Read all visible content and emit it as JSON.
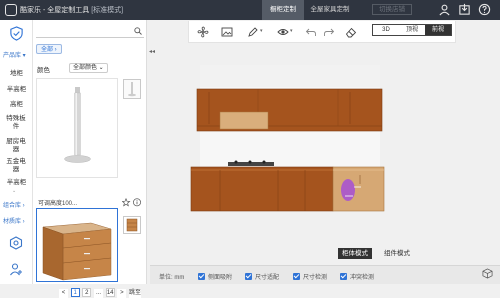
{
  "titlebar": {
    "app_name": "酷家乐 - 全屋定制工具",
    "mode": "[标准模式]",
    "tabs": [
      {
        "label": "橱柜定制",
        "state": "active"
      },
      {
        "label": "全屋家具定制",
        "state": "normal"
      },
      {
        "label": "切换店铺",
        "state": "disabled"
      }
    ],
    "icons": [
      "user-icon",
      "export-icon",
      "help-icon"
    ]
  },
  "sidebar": {
    "header": "产品库",
    "items": [
      "地柜",
      "半高柜",
      "高柜",
      "特殊板件",
      "厨房电器",
      "五金电器",
      "半高柜"
    ],
    "sections": [
      "组合库",
      "材质库"
    ]
  },
  "panel": {
    "search_placeholder": "",
    "breadcrumb_chip": "全部",
    "filter_label": "颜色",
    "filter_value": "全部颜色",
    "card_name": "可调高度100...",
    "pagination": {
      "prev": "<",
      "pages": [
        "1",
        "2",
        "...",
        "14"
      ],
      "next": ">",
      "jump": "跳至"
    }
  },
  "toolbar": {
    "tools": [
      "fan-icon",
      "image-icon",
      "pen-icon",
      "eye-icon",
      "undo-icon",
      "redo-icon",
      "eraser-icon"
    ],
    "view_modes": [
      "3D",
      "顶视",
      "前视"
    ],
    "active_view": "前视"
  },
  "canvas": {
    "mode_buttons": {
      "cabinet": "柜体模式",
      "component": "组件模式"
    },
    "active_mode": "柜体模式"
  },
  "statusbar": {
    "unit_label": "单位: mm",
    "items": [
      {
        "label": "侧面吸附",
        "checked": true
      },
      {
        "label": "尺寸适配",
        "checked": true
      },
      {
        "label": "尺寸检测",
        "checked": true
      },
      {
        "label": "冲突检测",
        "checked": true
      }
    ]
  },
  "colors": {
    "accent": "#2f73d6",
    "titlebar_bg": "#2f3540",
    "wood": "#a5541e",
    "highlight": "#a64fd6"
  }
}
